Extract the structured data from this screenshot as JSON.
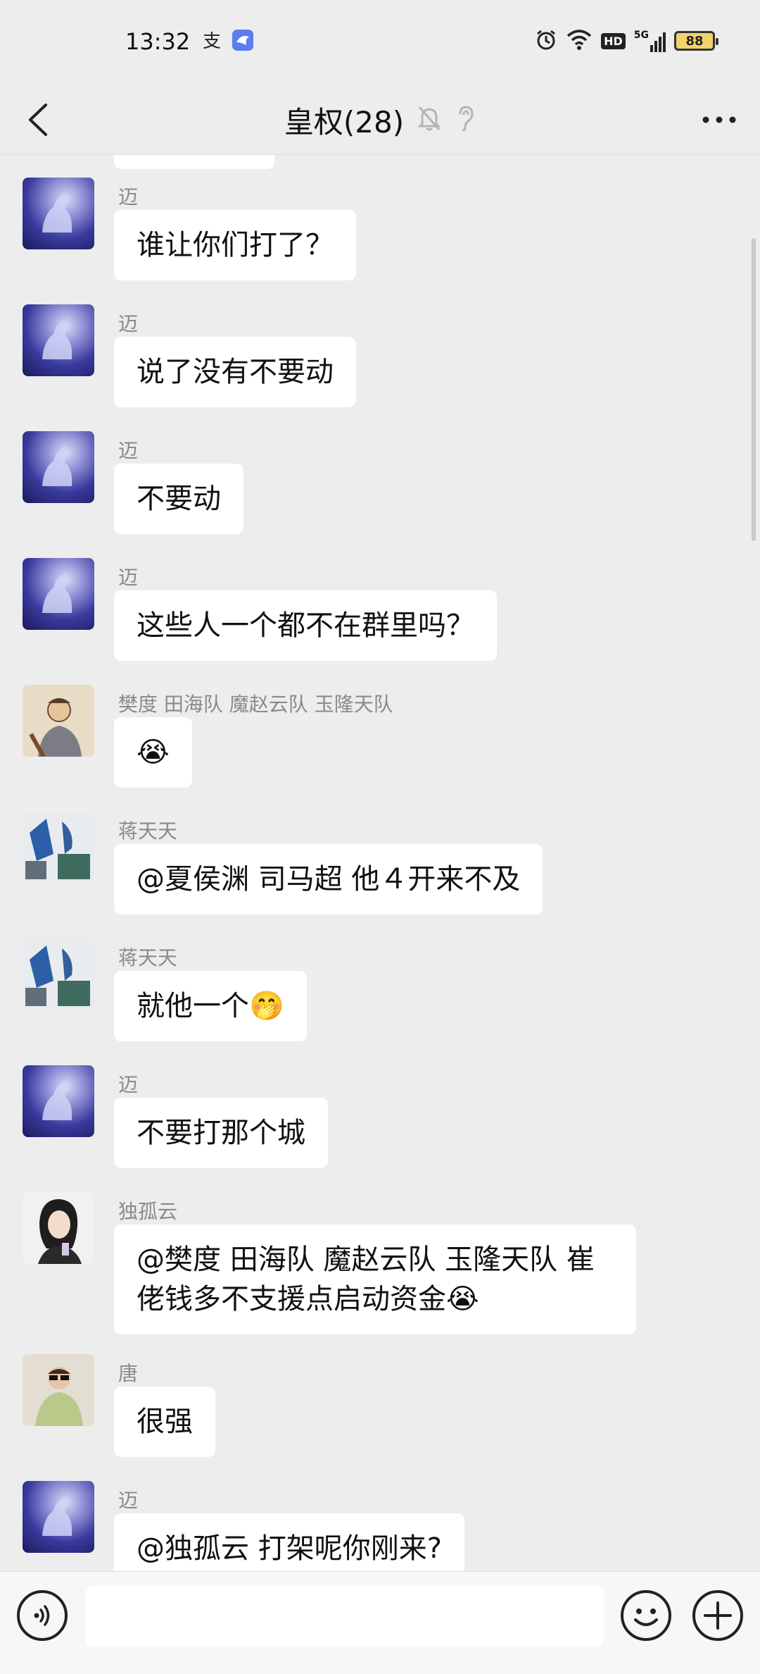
{
  "status_bar": {
    "time": "13:32",
    "network": "5G",
    "hd": "HD",
    "battery": "88"
  },
  "header": {
    "title": "皇权(28)"
  },
  "messages": [
    {
      "sender": "迈",
      "text": "谁让你们打了？",
      "avatar": "moon-horse"
    },
    {
      "sender": "迈",
      "text": "说了没有不要动",
      "avatar": "moon-horse"
    },
    {
      "sender": "迈",
      "text": "不要动",
      "avatar": "moon-horse"
    },
    {
      "sender": "迈",
      "text": "这些人一个都不在群里吗？",
      "avatar": "moon-horse"
    },
    {
      "sender": "樊度 田海队 魔赵云队 玉隆天队",
      "text": "😭",
      "avatar": "old-man"
    },
    {
      "sender": "蒋天天",
      "text": "@夏侯渊  司马超  他４开来不及",
      "avatar": "blue-figure"
    },
    {
      "sender": "蒋天天",
      "text": "就他一个🤭",
      "avatar": "blue-figure"
    },
    {
      "sender": "迈",
      "text": "不要打那个城",
      "avatar": "moon-horse"
    },
    {
      "sender": "独孤云",
      "text": "@樊度 田海队 魔赵云队 玉隆天队  崔佬钱多不支援点启动资金😭",
      "avatar": "girl-black-hair"
    },
    {
      "sender": "唐",
      "text": "很强",
      "avatar": "boy-sunglasses"
    },
    {
      "sender": "迈",
      "text": "@独孤云  打架呢你刚来?",
      "avatar": "moon-horse"
    }
  ],
  "input_bar": {
    "placeholder": ""
  }
}
